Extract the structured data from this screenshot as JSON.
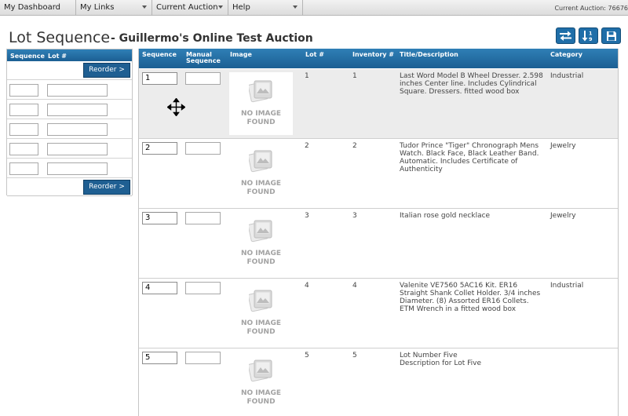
{
  "nav": {
    "items": [
      {
        "label": "My Dashboard",
        "dropdown": false
      },
      {
        "label": "My Links",
        "dropdown": true
      },
      {
        "label": "Current Auction",
        "dropdown": true
      },
      {
        "label": "Help",
        "dropdown": true
      }
    ],
    "current_auction": "Current Auction: 76676"
  },
  "header": {
    "title": "Lot Sequence",
    "subtitle": "- Guillermo's Online Test Auction",
    "buttons": [
      "swap-icon",
      "sort-numeric-icon",
      "save-icon"
    ]
  },
  "left_panel": {
    "col_sequence": "Sequence",
    "col_lot": "Lot #",
    "reorder_label": "Reorder >",
    "row_count": 5
  },
  "table": {
    "headers": {
      "sequence": "Sequence",
      "manual_sequence": "Manual Sequence",
      "image": "Image",
      "lot": "Lot #",
      "inventory": "Inventory #",
      "title": "Title/Description",
      "category": "Category"
    },
    "no_image_text": "NO IMAGE FOUND",
    "rows": [
      {
        "sequence": "1",
        "lot": "1",
        "inventory": "1",
        "description": "Last Word Model B Wheel Dresser. 2.598 inches Center line. Includes Cylindrical Square. Dressers. fitted wood box",
        "category": "Industrial",
        "selected": true
      },
      {
        "sequence": "2",
        "lot": "2",
        "inventory": "2",
        "description": "Tudor Prince \"Tiger\" Chronograph Mens Watch. Black Face, Black Leather Band. Automatic. Includes Certificate of Authenticity",
        "category": "Jewelry",
        "selected": false
      },
      {
        "sequence": "3",
        "lot": "3",
        "inventory": "3",
        "description": "Italian rose gold necklace",
        "category": "Jewelry",
        "selected": false
      },
      {
        "sequence": "4",
        "lot": "4",
        "inventory": "4",
        "description": "Valenite VE7560 5AC16 Kit. ER16 Straight Shank Collet Holder. 3/4 inches Diameter. (8) Assorted ER16 Collets. ETM Wrench in a fitted wood box",
        "category": "Industrial",
        "selected": false
      },
      {
        "sequence": "5",
        "lot": "5",
        "inventory": "5",
        "description": "Lot Number Five\nDescription for Lot Five",
        "category": "",
        "selected": false
      }
    ]
  },
  "colors": {
    "header_blue": "#1f6ea8",
    "selected_row": "#ececec"
  }
}
